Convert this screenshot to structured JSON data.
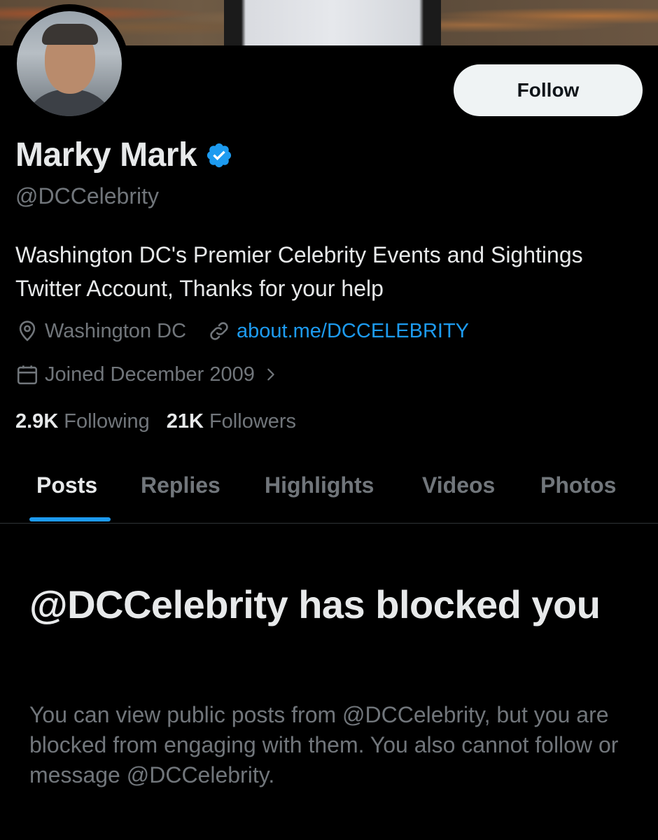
{
  "profile": {
    "display_name": "Marky Mark",
    "handle": "@DCCelebrity",
    "bio": "Washington DC's Premier Celebrity Events and Sightings Twitter Account, Thanks for your help",
    "location": "Washington DC",
    "website": "about.me/DCCELEBRITY",
    "joined": "Joined December 2009",
    "verified": true
  },
  "actions": {
    "follow_label": "Follow"
  },
  "stats": {
    "following_count": "2.9K",
    "following_label": "Following",
    "followers_count": "21K",
    "followers_label": "Followers"
  },
  "tabs": [
    {
      "label": "Posts",
      "active": true
    },
    {
      "label": "Replies",
      "active": false
    },
    {
      "label": "Highlights",
      "active": false
    },
    {
      "label": "Videos",
      "active": false
    },
    {
      "label": "Photos",
      "active": false
    }
  ],
  "blocked": {
    "title": "@DCCelebrity has blocked you",
    "description": "You can view public posts from @DCCelebrity, but you are blocked from engaging with them. You also cannot follow or message @DCCelebrity."
  },
  "icons": {
    "verified": "verified-badge-icon",
    "location": "location-pin-icon",
    "link": "link-icon",
    "calendar": "calendar-icon",
    "chevron": "chevron-right-icon"
  },
  "colors": {
    "background": "#000000",
    "accent": "#1d9bf0",
    "primary_text": "#e7e9ea",
    "secondary_text": "#71767b",
    "follow_button_bg": "#eff3f4"
  }
}
